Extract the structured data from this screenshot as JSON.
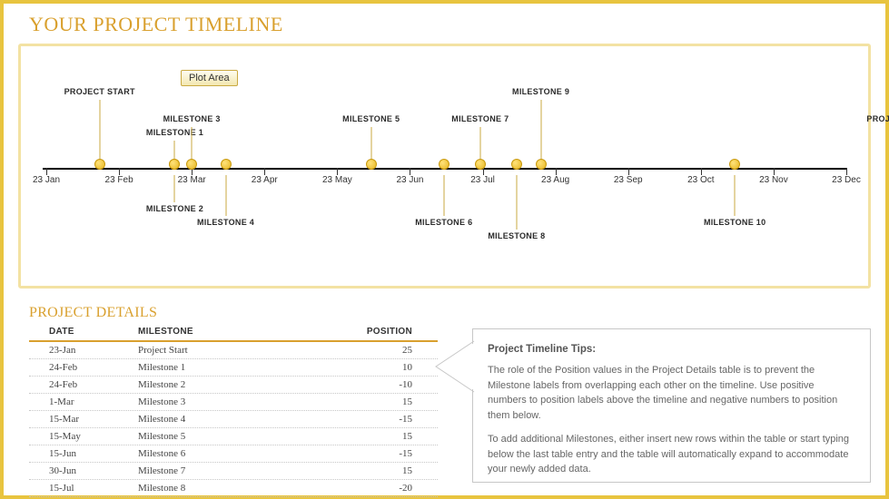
{
  "title": "YOUR PROJECT TIMELINE",
  "plot_area_label": "Plot Area",
  "chart_data": {
    "type": "scatter",
    "xlabel": "",
    "ylabel": "",
    "x_ticks": [
      "23 Jan",
      "23 Feb",
      "23 Mar",
      "23 Apr",
      "23 May",
      "23 Jun",
      "23 Jul",
      "23 Aug",
      "23 Sep",
      "23 Oct",
      "23 Nov",
      "23 Dec"
    ],
    "y_range": [
      -25,
      25
    ],
    "series": [
      {
        "name": "milestones",
        "points": [
          {
            "date": "23-Jan",
            "label": "PROJECT START",
            "position": 25
          },
          {
            "date": "24-Feb",
            "label": "MILESTONE 1",
            "position": 10
          },
          {
            "date": "24-Feb",
            "label": "MILESTONE 2",
            "position": -10
          },
          {
            "date": "1-Mar",
            "label": "MILESTONE 3",
            "position": 15
          },
          {
            "date": "15-Mar",
            "label": "MILESTONE 4",
            "position": -15
          },
          {
            "date": "15-May",
            "label": "MILESTONE 5",
            "position": 15
          },
          {
            "date": "15-Jun",
            "label": "MILESTONE 6",
            "position": -15
          },
          {
            "date": "30-Jun",
            "label": "MILESTONE 7",
            "position": 15
          },
          {
            "date": "15-Jul",
            "label": "MILESTONE 8",
            "position": -20
          },
          {
            "date": "25-Jul",
            "label": "MILESTONE 9",
            "position": 25
          },
          {
            "date": "15-Oct",
            "label": "MILESTONE 10",
            "position": -15
          },
          {
            "date": "22-Dec",
            "label": "PROJECT END",
            "position": 15
          }
        ]
      }
    ]
  },
  "details": {
    "heading": "PROJECT DETAILS",
    "columns": {
      "date": "DATE",
      "milestone": "MILESTONE",
      "position": "POSITION"
    },
    "rows": [
      {
        "date": "23-Jan",
        "milestone": "Project Start",
        "position": "25"
      },
      {
        "date": "24-Feb",
        "milestone": "Milestone 1",
        "position": "10"
      },
      {
        "date": "24-Feb",
        "milestone": "Milestone 2",
        "position": "-10"
      },
      {
        "date": "1-Mar",
        "milestone": "Milestone 3",
        "position": "15"
      },
      {
        "date": "15-Mar",
        "milestone": "Milestone 4",
        "position": "-15"
      },
      {
        "date": "15-May",
        "milestone": "Milestone 5",
        "position": "15"
      },
      {
        "date": "15-Jun",
        "milestone": "Milestone 6",
        "position": "-15"
      },
      {
        "date": "30-Jun",
        "milestone": "Milestone 7",
        "position": "15"
      },
      {
        "date": "15-Jul",
        "milestone": "Milestone 8",
        "position": "-20"
      }
    ]
  },
  "tips": {
    "heading": "Project Timeline Tips:",
    "p1": "The role of the Position values in the Project Details table is to prevent the Milestone labels from overlapping each other on the timeline. Use positive numbers to position labels above the timeline and negative numbers to position them below.",
    "p2": "To add additional Milestones, either insert new rows within the table or start typing below the last table entry and the table will automatically expand to accommodate your newly added data."
  }
}
